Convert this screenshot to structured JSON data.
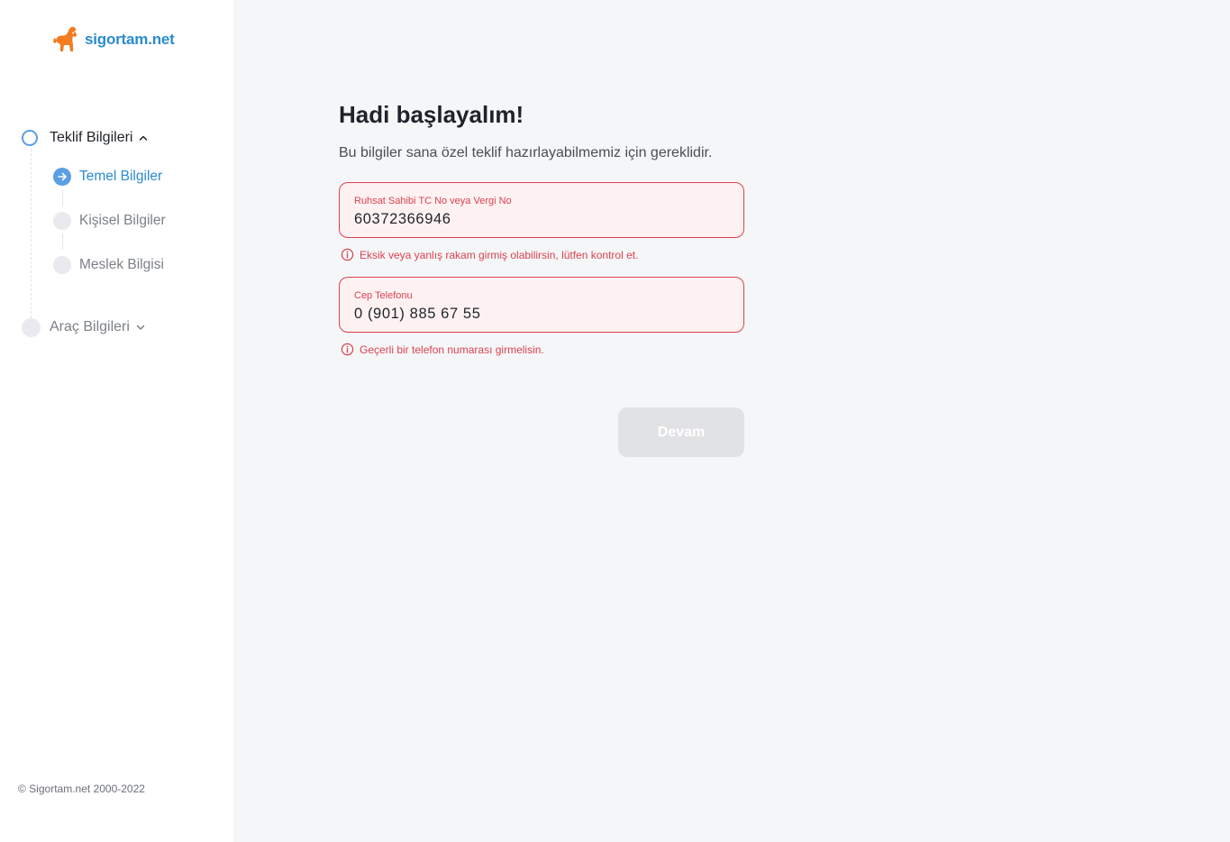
{
  "brand": {
    "name": "sigortam.net",
    "logo_icon": "goat-logo-icon",
    "primary_color": "#2a8bd0",
    "logo_color": "#f47b20"
  },
  "sidebar": {
    "steps": [
      {
        "label": "Teklif Bilgileri",
        "state": "active",
        "expanded": true,
        "chevron_icon": "chevron-up-icon",
        "substeps": [
          {
            "label": "Temel Bilgiler",
            "state": "current",
            "icon": "arrow-right-icon"
          },
          {
            "label": "Kişisel Bilgiler",
            "state": "pending"
          },
          {
            "label": "Meslek Bilgisi",
            "state": "pending"
          }
        ]
      },
      {
        "label": "Araç Bilgileri",
        "state": "inactive",
        "expanded": false,
        "chevron_icon": "chevron-down-icon"
      }
    ],
    "copyright": "© Sigortam.net 2000-2022"
  },
  "form": {
    "title": "Hadi başlayalım!",
    "subtitle": "Bu bilgiler sana özel teklif hazırlayabilmemiz için gereklidir.",
    "fields": {
      "id_number": {
        "label": "Ruhsat Sahibi TC No veya Vergi No",
        "value": "60372366946",
        "error": "Eksik veya yanlış rakam girmiş olabilirsin, lütfen kontrol et."
      },
      "phone": {
        "label": "Cep Telefonu",
        "value": "0 (901) 885 67 55",
        "error": "Geçerli bir telefon numarası girmelisin."
      }
    },
    "error_icon": "info-circle-icon",
    "error_color": "#d9434f",
    "submit_label": "Devam",
    "submit_disabled": true
  }
}
